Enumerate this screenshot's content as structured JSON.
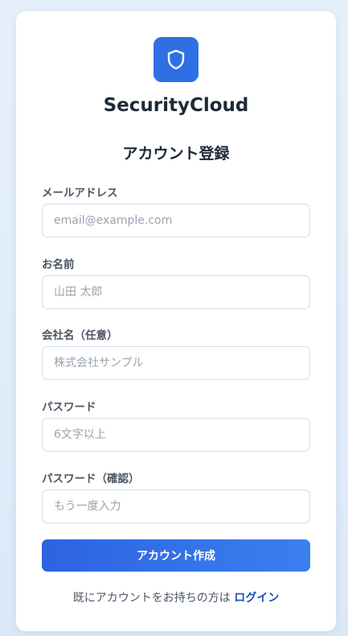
{
  "brand": {
    "name": "SecurityCloud",
    "accent": "#2f6fe4",
    "logo_icon": "shield-icon"
  },
  "form": {
    "title": "アカウント登録",
    "email": {
      "label": "メールアドレス",
      "placeholder": "email@example.com",
      "value": ""
    },
    "name": {
      "label": "お名前",
      "placeholder": "山田 太郎",
      "value": ""
    },
    "company": {
      "label": "会社名（任意）",
      "placeholder": "株式会社サンプル",
      "value": ""
    },
    "password": {
      "label": "パスワード",
      "placeholder": "6文字以上",
      "value": ""
    },
    "password_confirm": {
      "label": "パスワード（確認）",
      "placeholder": "もう一度入力",
      "value": ""
    },
    "submit_label": "アカウント作成"
  },
  "footer": {
    "text": "既にアカウントをお持ちの方は",
    "login_link": "ログイン"
  }
}
